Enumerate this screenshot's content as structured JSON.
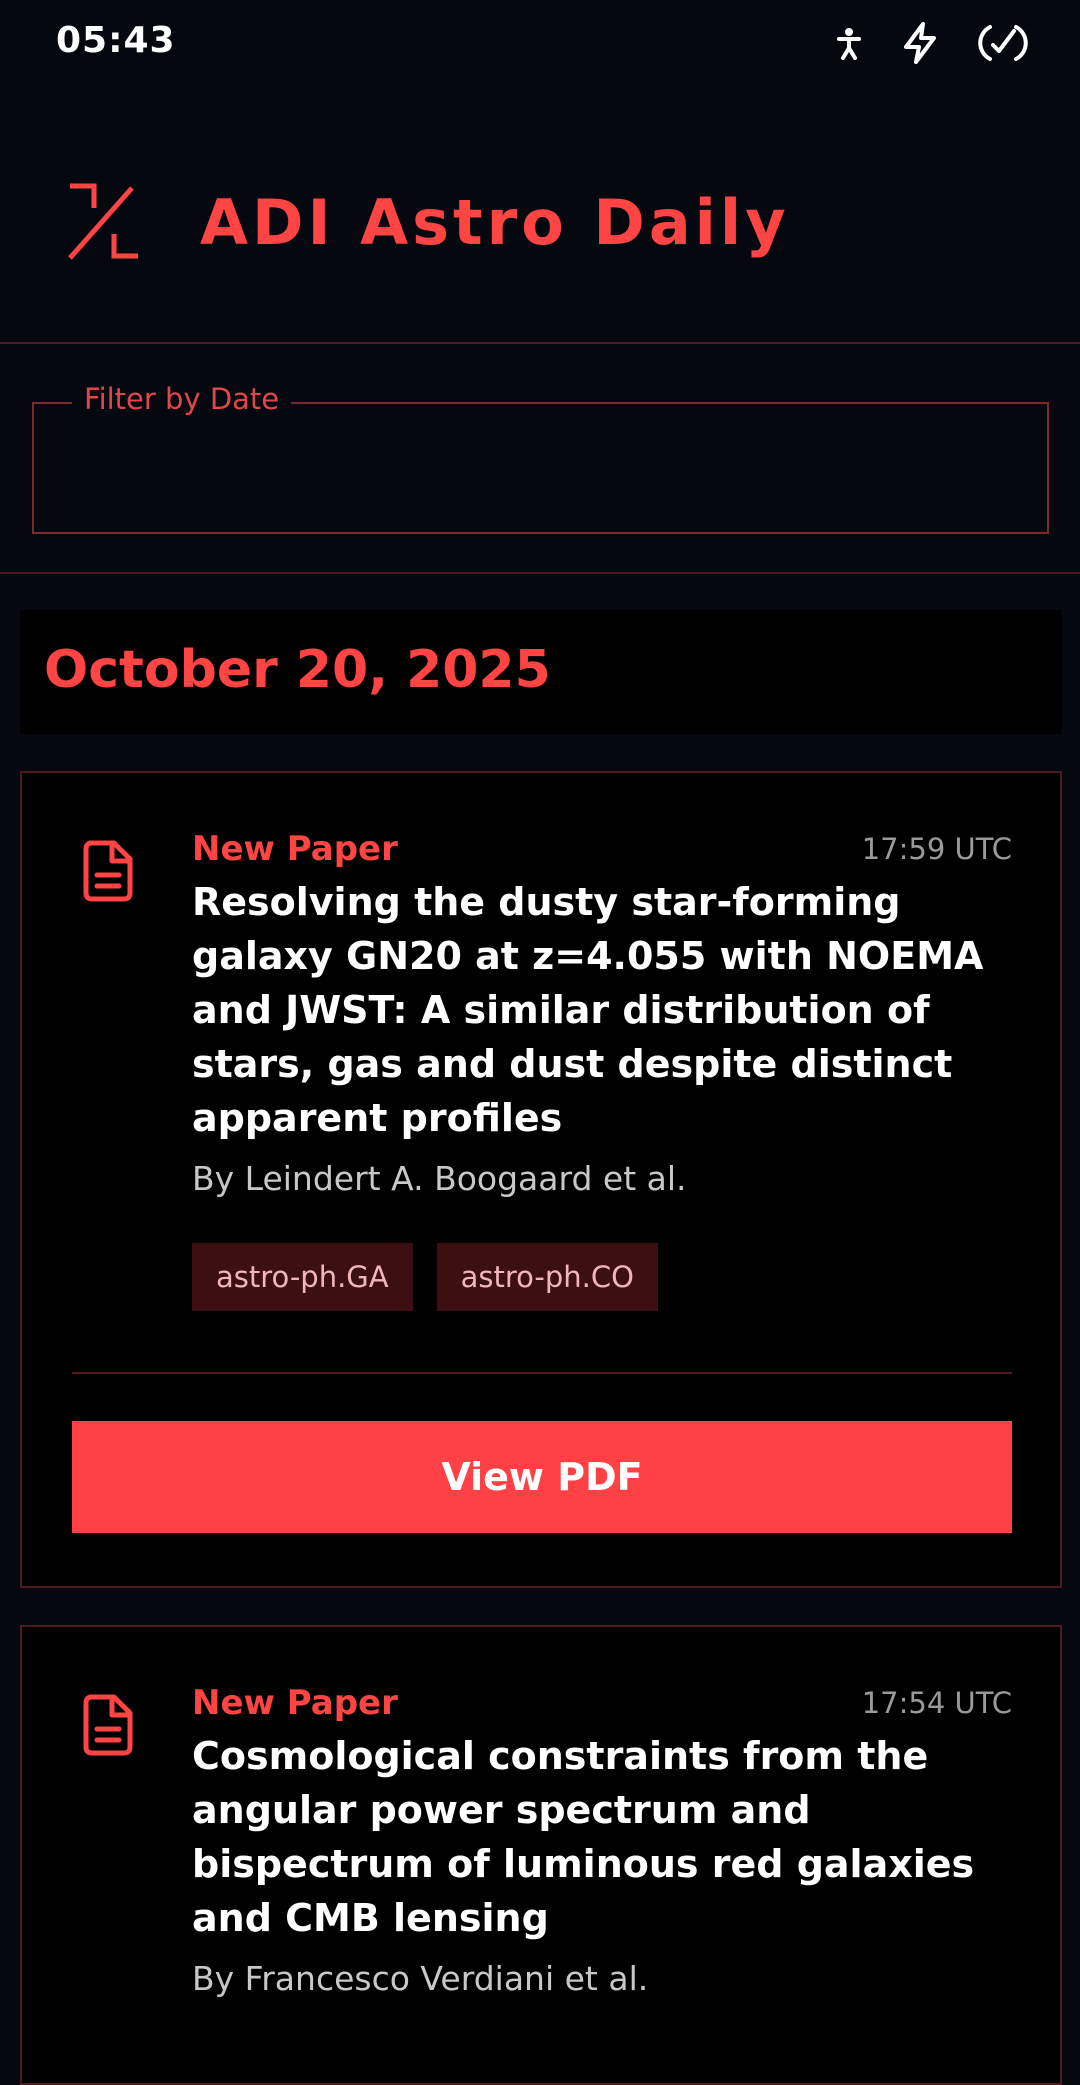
{
  "status_bar": {
    "time": "05:43",
    "icons": [
      "accessibility-icon",
      "flash-icon",
      "battery-saver-icon"
    ]
  },
  "header": {
    "logo_icon": "app-logo-icon",
    "title": "ADI Astro Daily"
  },
  "filter": {
    "label": "Filter by Date",
    "value": ""
  },
  "date_group": {
    "date": "October 20, 2025"
  },
  "papers": [
    {
      "icon": "document-icon",
      "kind": "New Paper",
      "time": "17:59 UTC",
      "title": "Resolving the dusty star-forming galaxy GN20 at z=4.055 with NOEMA and JWST: A similar distribution of stars, gas and dust despite distinct apparent profiles",
      "authors": "By Leindert A. Boogaard et al.",
      "tags": [
        "astro-ph.GA",
        "astro-ph.CO"
      ],
      "button_label": "View PDF"
    },
    {
      "icon": "document-icon",
      "kind": "New Paper",
      "time": "17:54 UTC",
      "title": "Cosmological constraints from the angular power spectrum and bispectrum of luminous red galaxies and CMB lensing",
      "authors": "By Francesco Verdiani et al."
    }
  ],
  "colors": {
    "accent": "#ff4444",
    "background": "#05080f",
    "card": "#000000",
    "tag_bg": "#3c1012",
    "border": "#4e1a1e"
  }
}
